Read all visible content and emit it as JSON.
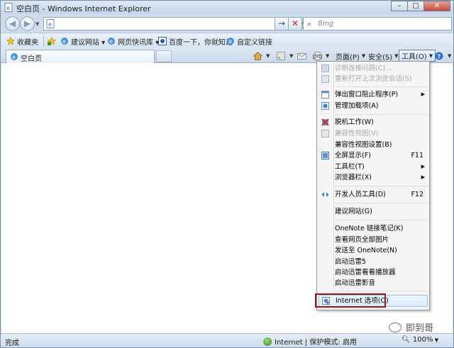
{
  "window": {
    "title": "空白页 - Windows Internet Explorer",
    "min_label": "–",
    "max_label": "□",
    "close_label": "✕"
  },
  "navbar": {
    "back_label": "◀",
    "forward_label": "▶",
    "address_value": "",
    "go_label": "→",
    "stop_label": "✕",
    "search_placeholder": "Bing"
  },
  "favbar": {
    "favorites_label": "收藏夹",
    "items": [
      {
        "label": "建议网站 ▾",
        "icon": "ie-icon"
      },
      {
        "label": "网页快讯库 ▾",
        "icon": "slice-icon"
      },
      {
        "label": "百度一下，你就知道",
        "icon": "baidu-icon"
      },
      {
        "label": "自定义链接",
        "icon": "ie-icon"
      }
    ]
  },
  "tabbar": {
    "tab_title": "空白页",
    "commands": {
      "page": "页面(P)",
      "safety": "安全(S)",
      "tools": "工具(O)"
    }
  },
  "tools_menu": {
    "items": [
      {
        "label": "诊断连接问题(C)...",
        "disabled": true
      },
      {
        "label": "重新打开上次浏览会话(S)",
        "disabled": true
      },
      {
        "label": "弹出窗口阻止程序(P)",
        "submenu": true
      },
      {
        "label": "管理加载项(A)"
      },
      {
        "label": "脱机工作(W)"
      },
      {
        "label": "兼容性视图(V)",
        "disabled": true
      },
      {
        "label": "兼容性视图设置(B)"
      },
      {
        "label": "全屏显示(F)",
        "shortcut": "F11"
      },
      {
        "label": "工具栏(T)",
        "submenu": true
      },
      {
        "label": "浏览器栏(X)",
        "submenu": true
      },
      {
        "label": "开发人员工具(D)",
        "shortcut": "F12"
      },
      {
        "label": "建议网站(G)"
      },
      {
        "label": "OneNote 链接笔记(K)"
      },
      {
        "label": "查看网页全部图片"
      },
      {
        "label": "发送至 OneNote(N)"
      },
      {
        "label": "启动迅雷5"
      },
      {
        "label": "启动迅雷看看播放器"
      },
      {
        "label": "启动迅雷影音"
      },
      {
        "label": "Internet 选项(O)",
        "highlighted": true
      }
    ]
  },
  "status": {
    "left": "完成",
    "zone": "Internet | 保护模式: 启用",
    "zoom": "100%"
  },
  "watermark": {
    "text": "即到哥"
  },
  "colors": {
    "chrome": "#cfdcea",
    "highlight_border": "#8b1c1c",
    "menu_bg": "#f5f5f5"
  }
}
